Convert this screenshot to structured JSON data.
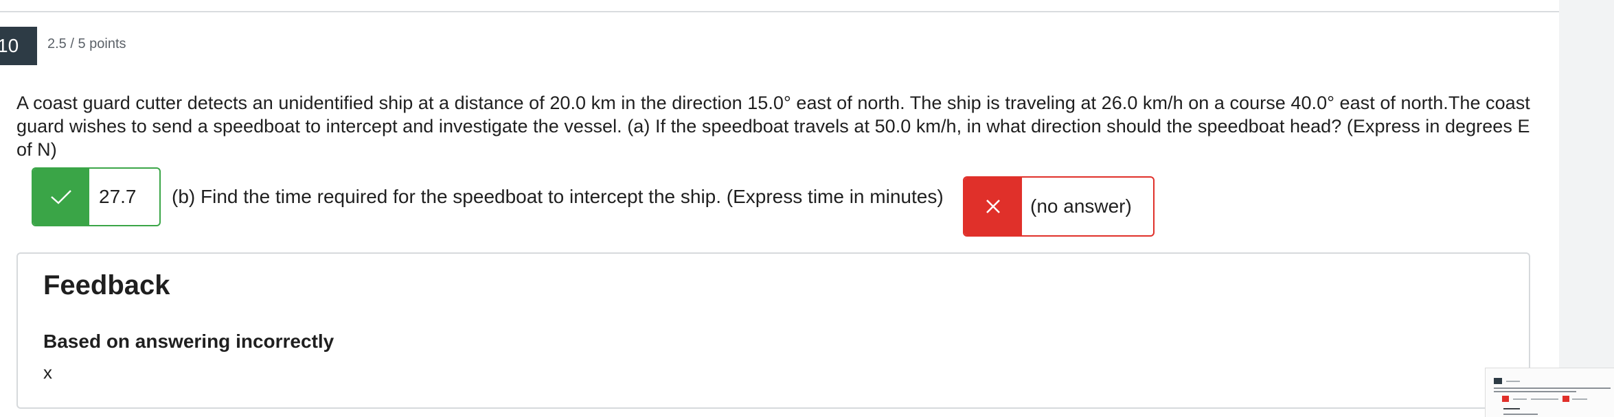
{
  "question": {
    "number": "10",
    "points": "2.5 / 5 points",
    "text": "A coast guard cutter detects an unidentified ship at a distance of 20.0 km in the direction 15.0° east of north. The ship is traveling at 26.0 km/h on a course 40.0° east of north.The coast guard wishes to send a speedboat to intercept and investigate the vessel. (a) If the speedboat travels at 50.0 km/h, in what direction should the speedboat head? (Express in degrees E of N)"
  },
  "answers": {
    "part_a": {
      "value": "27.7",
      "status": "correct",
      "status_icon": "check-icon"
    },
    "part_b_prompt": "(b) Find the time required for the speedboat to intercept the ship. (Express time in minutes)",
    "part_b": {
      "value": "(no answer)",
      "status": "incorrect",
      "status_icon": "x-icon"
    }
  },
  "feedback": {
    "title": "Feedback",
    "subtitle": "Based on answering incorrectly",
    "text": "x"
  },
  "colors": {
    "correct": "#3aa547",
    "incorrect": "#e0302a",
    "question_number_bg": "#2d3b45",
    "muted_text": "#5b6168",
    "border": "#d6d9dc"
  }
}
